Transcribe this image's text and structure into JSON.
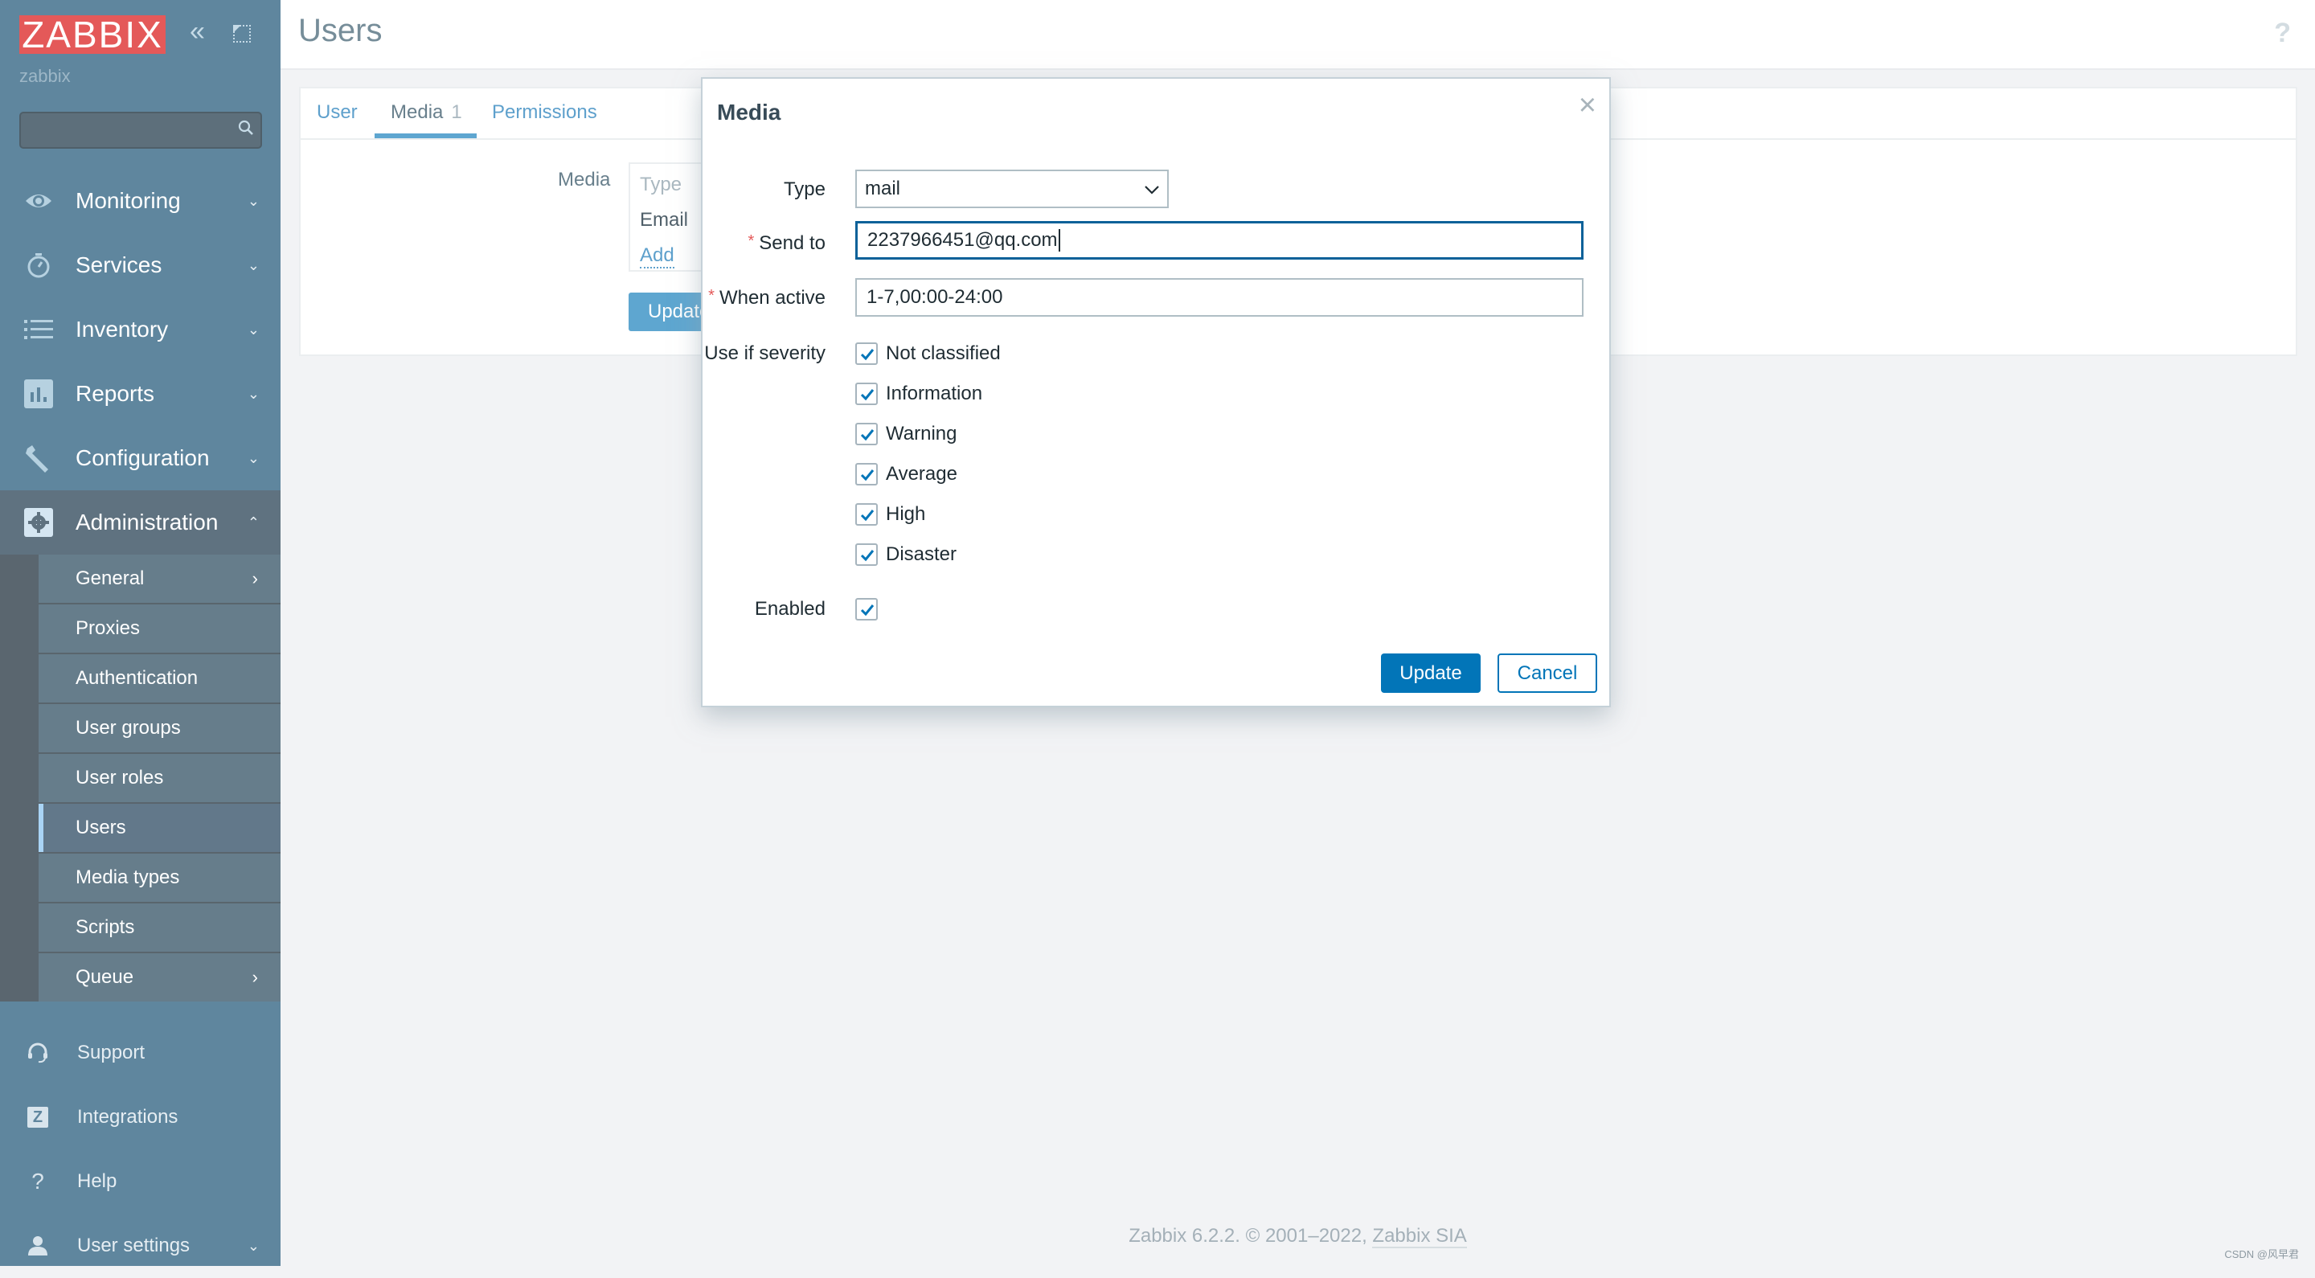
{
  "sidebar": {
    "logo": "ZABBIX",
    "server_name": "zabbix",
    "search": {
      "placeholder": "",
      "value": ""
    },
    "menu": [
      {
        "label": "Monitoring",
        "icon": "eye-icon",
        "expanded": false
      },
      {
        "label": "Services",
        "icon": "stopwatch-icon",
        "expanded": false
      },
      {
        "label": "Inventory",
        "icon": "list-icon",
        "expanded": false
      },
      {
        "label": "Reports",
        "icon": "bar-chart-icon",
        "expanded": false
      },
      {
        "label": "Configuration",
        "icon": "wrench-icon",
        "expanded": false
      },
      {
        "label": "Administration",
        "icon": "gear-icon",
        "expanded": true
      }
    ],
    "admin_submenu": [
      {
        "label": "General",
        "has_submenu": true
      },
      {
        "label": "Proxies"
      },
      {
        "label": "Authentication"
      },
      {
        "label": "User groups"
      },
      {
        "label": "User roles"
      },
      {
        "label": "Users",
        "selected": true
      },
      {
        "label": "Media types"
      },
      {
        "label": "Scripts"
      },
      {
        "label": "Queue",
        "has_submenu": true
      }
    ],
    "bottom": [
      {
        "label": "Support",
        "icon": "headset-icon"
      },
      {
        "label": "Integrations",
        "icon": "zabbix-z-icon",
        "icon_text": "Z"
      },
      {
        "label": "Help",
        "icon": "question-icon",
        "icon_text": "?"
      },
      {
        "label": "User settings",
        "icon": "user-icon"
      }
    ]
  },
  "header": {
    "title": "Users",
    "help": "?"
  },
  "tabs": [
    {
      "label": "User"
    },
    {
      "label": "Media",
      "count": "1",
      "active": true
    },
    {
      "label": "Permissions"
    }
  ],
  "media_form": {
    "label": "Media",
    "table_header": "Type",
    "rows": [
      "Email"
    ],
    "add_link": "Add",
    "update_button": "Update"
  },
  "dialog": {
    "title": "Media",
    "close": "×",
    "type_label": "Type",
    "type_value": "mail",
    "send_to_label": "Send to",
    "send_to_value": "2237966451@qq.com",
    "when_active_label": "When active",
    "when_active_value": "1-7,00:00-24:00",
    "severity_label": "Use if severity",
    "severities": [
      {
        "label": "Not classified",
        "checked": true
      },
      {
        "label": "Information",
        "checked": true
      },
      {
        "label": "Warning",
        "checked": true
      },
      {
        "label": "Average",
        "checked": true
      },
      {
        "label": "High",
        "checked": true
      },
      {
        "label": "Disaster",
        "checked": true
      }
    ],
    "enabled_label": "Enabled",
    "enabled": true,
    "update_button": "Update",
    "cancel_button": "Cancel"
  },
  "footer": {
    "text": "Zabbix 6.2.2. © 2001–2022, ",
    "link": "Zabbix SIA"
  },
  "watermark": "CSDN @风早君",
  "colors": {
    "sidebar_bg": "#5f869e",
    "logo_bg": "#e45959",
    "primary": "#0275b8",
    "link": "#5ea0cc"
  }
}
